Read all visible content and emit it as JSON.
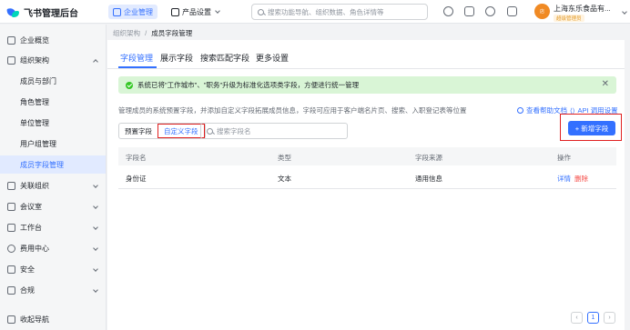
{
  "app": {
    "title": "飞书管理后台"
  },
  "topnav": {
    "enterprise": "企业管理",
    "product": "产品设置"
  },
  "search": {
    "placeholder": "搜索功能导航、组织数据、角色详情等"
  },
  "account": {
    "avatar_text": "店",
    "org_name": "上海东乐食品有...",
    "badge": "超级管理员"
  },
  "sidebar": {
    "items": [
      {
        "label": "企业概览",
        "icon": "grid-icon"
      },
      {
        "label": "组织架构",
        "icon": "org-icon"
      },
      {
        "label": "关联组织",
        "icon": "link-icon"
      },
      {
        "label": "会议室",
        "icon": "room-icon"
      },
      {
        "label": "工作台",
        "icon": "apps-icon"
      },
      {
        "label": "费用中心",
        "icon": "coin-icon"
      },
      {
        "label": "安全",
        "icon": "shield-icon"
      },
      {
        "label": "合规",
        "icon": "check-icon"
      },
      {
        "label": "收起导航",
        "icon": "collapse-icon"
      }
    ],
    "subitems": [
      "成员与部门",
      "角色管理",
      "单位管理",
      "用户组管理",
      "成员字段管理"
    ]
  },
  "breadcrumb": {
    "parent": "组织架构",
    "sep": "/",
    "current": "成员字段管理"
  },
  "tabs": [
    "字段管理",
    "展示字段",
    "搜索匹配字段",
    "更多设置"
  ],
  "notice": {
    "text": "系统已将\"工作城市\"、\"职务\"升级为标准化选项类字段，方便进行统一管理",
    "close": "✕"
  },
  "description": "管理成员的系统预置字段，并添加自定义字段拓展成员信息，字段可应用于客户端名片页、搜索、入职登记表等位置",
  "links": {
    "help": "查看帮助文档",
    "api": "API 调用设置"
  },
  "filter": {
    "preset": "预置字段",
    "custom": "自定义字段",
    "search_placeholder": "搜索字段名"
  },
  "add_button": "+ 新增字段",
  "table": {
    "headers": [
      "字段名",
      "类型",
      "字段来源",
      "操作"
    ],
    "rows": [
      {
        "name": "身份证",
        "type": "文本",
        "source": "通用信息",
        "edit": "详情",
        "delete": "删除"
      }
    ]
  },
  "pagination": {
    "prev": "‹",
    "current": "1",
    "next": "›"
  },
  "colors": {
    "accent": "#3370ff",
    "danger": "#f54a45",
    "notice_bg": "#d9f5d6",
    "highlight_border": "#e02020"
  }
}
